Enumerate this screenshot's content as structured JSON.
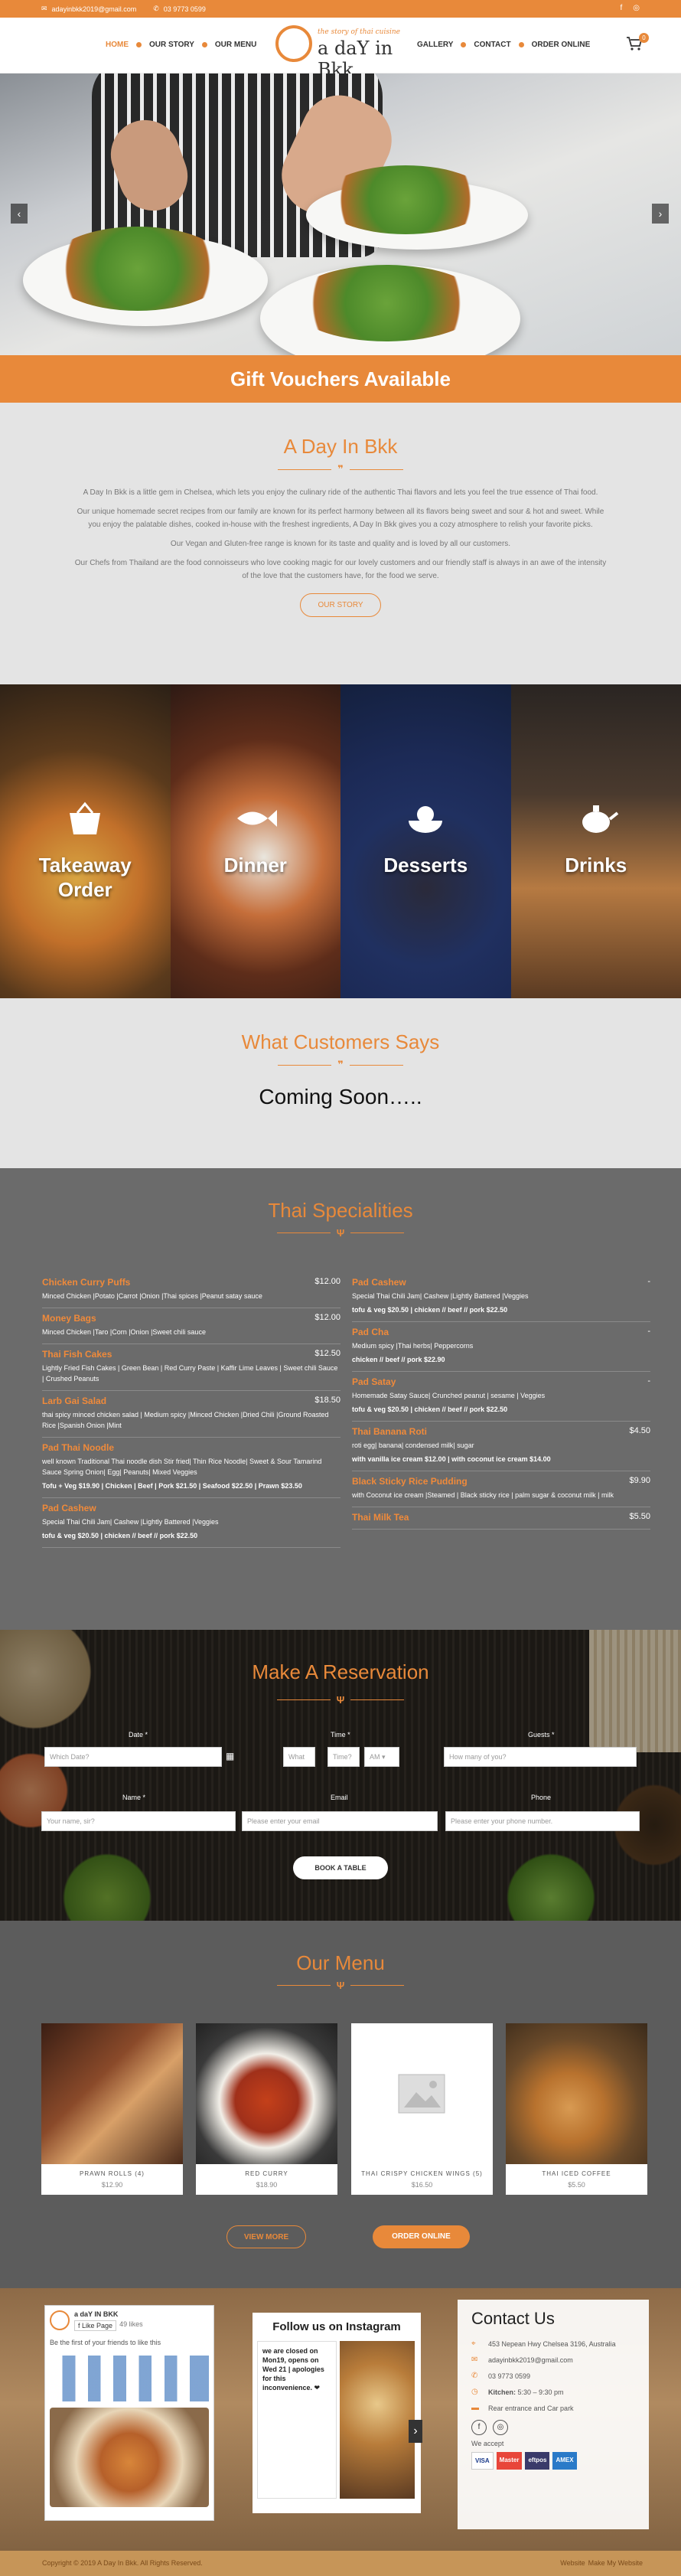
{
  "topbar": {
    "email": "adayinbkk2019@gmail.com",
    "phone": "03 9773 0599"
  },
  "nav": {
    "left": [
      "HOME",
      "OUR STORY",
      "OUR MENU"
    ],
    "right": [
      "GALLERY",
      "CONTACT",
      "ORDER ONLINE"
    ]
  },
  "logo": {
    "tagline": "the story of thai cuisine",
    "name": "a daY in Bkk"
  },
  "cart": {
    "count": "0"
  },
  "gift": {
    "text": "Gift Vouchers Available"
  },
  "about": {
    "title": "A Day In Bkk",
    "p1": "A Day In Bkk is a little gem in Chelsea, which lets you enjoy the culinary ride of the authentic Thai flavors and lets you feel the true essence of Thai food.",
    "p2": "Our unique homemade secret recipes from our family are known for its perfect harmony between all its flavors being sweet and sour & hot and sweet. While you enjoy the palatable dishes, cooked in-house with the freshest ingredients, A Day In Bkk gives you a cozy atmosphere to relish your favorite picks.",
    "p3": "Our Vegan and Gluten-free range is known for its taste and quality and is loved by all our customers.",
    "p4": "Our Chefs from Thailand are the food connoisseurs who love cooking magic for our lovely customers and our friendly staff is always in an awe of the intensity of the love that the customers have, for the food we serve.",
    "button": "OUR STORY"
  },
  "categories": [
    {
      "label1": "Takeaway",
      "label2": "Order"
    },
    {
      "label1": "Dinner",
      "label2": ""
    },
    {
      "label1": "Desserts",
      "label2": ""
    },
    {
      "label1": "Drinks",
      "label2": ""
    }
  ],
  "testimonials": {
    "title": "What Customers Says",
    "text": "Coming Soon….."
  },
  "specialities": {
    "title": "Thai Specialities",
    "left": [
      {
        "name": "Chicken Curry Puffs",
        "price": "$12.00",
        "desc": "Minced Chicken |Potato |Carrot |Onion |Thai spices |Peanut satay sauce",
        "extra": ""
      },
      {
        "name": "Money Bags",
        "price": "$12.00",
        "desc": "Minced Chicken |Taro |Corn |Onion |Sweet chili sauce",
        "extra": ""
      },
      {
        "name": "Thai Fish Cakes",
        "price": "$12.50",
        "desc": "Lightly Fried Fish Cakes | Green Bean | Red Curry Paste | Kaffir Lime Leaves | Sweet chili Sauce | Crushed Peanuts",
        "extra": ""
      },
      {
        "name": "Larb Gai Salad",
        "price": "$18.50",
        "desc": "thai spicy minced chicken salad | Medium spicy |Minced Chicken |Dried Chili |Ground Roasted Rice |Spanish Onion |Mint",
        "extra": ""
      },
      {
        "name": "Pad Thai Noodle",
        "price": "",
        "desc": "well known Traditional Thai noodle dish Stir fried| Thin Rice Noodle| Sweet & Sour Tamarind Sauce Spring Onion| Egg| Peanuts| Mixed Veggies",
        "extra": "Tofu + Veg $19.90 | Chicken | Beef | Pork $21.50 | Seafood $22.50 | Prawn $23.50"
      },
      {
        "name": "Pad Cashew",
        "price": "",
        "desc": "Special Thai Chili Jam| Cashew |Lightly Battered |Veggies",
        "extra": "tofu & veg $20.50 | chicken // beef // pork $22.50"
      }
    ],
    "right": [
      {
        "name": "Pad Cashew",
        "price": "-",
        "desc": "Special Thai Chili Jam| Cashew |Lightly Battered |Veggies",
        "extra": "tofu & veg $20.50 | chicken // beef // pork $22.50"
      },
      {
        "name": "Pad Cha",
        "price": "-",
        "desc": "Medium spicy |Thai herbs| Peppercorns",
        "extra": "chicken // beef // pork $22.90"
      },
      {
        "name": "Pad Satay",
        "price": "-",
        "desc": "Homemade Satay Sauce| Crunched peanut | sesame | Veggies",
        "extra": "tofu & veg $20.50 | chicken // beef // pork $22.50"
      },
      {
        "name": "Thai Banana Roti",
        "price": "$4.50",
        "desc": "roti egg| banana| condensed milk| sugar",
        "extra": "with vanilla ice cream $12.00 | with coconut ice cream $14.00"
      },
      {
        "name": "Black Sticky Rice Pudding",
        "price": "$9.90",
        "desc": "with Coconut ice cream |Steamed | Black sticky rice | palm sugar & coconut milk | milk",
        "extra": ""
      },
      {
        "name": "Thai Milk Tea",
        "price": "$5.50",
        "desc": "",
        "extra": ""
      }
    ]
  },
  "reservation": {
    "title": "Make A Reservation",
    "date_label": "Date *",
    "date_placeholder": "Which Date?",
    "time_label": "Time *",
    "hour_placeholder": "What",
    "minute_placeholder": "Time?",
    "ampm": "AM",
    "guests_label": "Guests *",
    "guests_placeholder": "How many of you?",
    "name_label": "Name *",
    "name_placeholder": "Your name, sir?",
    "email_label": "Email",
    "email_placeholder": "Please enter your email",
    "phone_label": "Phone",
    "phone_placeholder": "Please enter your phone number.",
    "button": "BOOK A TABLE"
  },
  "menu": {
    "title": "Our Menu",
    "items": [
      {
        "name": "PRAWN ROLLS (4)",
        "price": "$12.90"
      },
      {
        "name": "RED CURRY",
        "price": "$18.90"
      },
      {
        "name": "THAI CRISPY CHICKEN WINGS (5)",
        "price": "$16.50"
      },
      {
        "name": "THAI ICED COFFEE",
        "price": "$5.50"
      }
    ],
    "view_more": "VIEW MORE",
    "order_online": "ORDER ONLINE"
  },
  "facebook": {
    "page_name": "a daY IN BKK",
    "like": "Like Page",
    "likes": "49 likes",
    "cta": "Be the first of your friends to like this"
  },
  "instagram": {
    "title": "Follow us on Instagram",
    "post": "we are closed on Mon19, opens on Wed 21 | apologies for this inconvenience. ❤"
  },
  "contact": {
    "title": "Contact Us",
    "address": "453 Nepean Hwy Chelsea 3196, Australia",
    "email": "adayinbkk2019@gmail.com",
    "phone": "03 9773 0599",
    "kitchen_label": "Kitchen:",
    "kitchen_hours": "5:30 – 9:30 pm",
    "parking": "Rear entrance and Car park",
    "accept_label": "We accept",
    "cards": [
      "VISA",
      "Master",
      "eftpos",
      "AMEX"
    ]
  },
  "bottom": {
    "copyright": "Copyright © 2019 A Day In Bkk. All Rights Reserved.",
    "credit_prefix": "Website",
    "credit": "Make My Website"
  }
}
